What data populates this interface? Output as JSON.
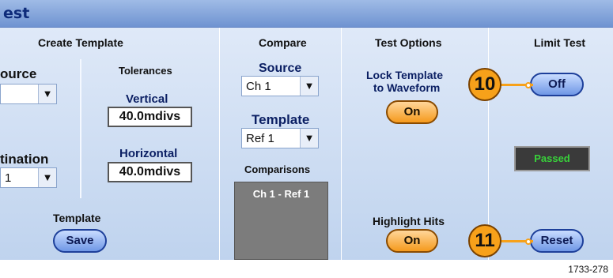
{
  "window": {
    "title": "est"
  },
  "create_template": {
    "section_title": "Create Template",
    "source_label": "ource",
    "source_value": "",
    "tolerances_label": "Tolerances",
    "vertical_label": "Vertical",
    "vertical_value": "40.0mdivs",
    "horizontal_label": "Horizontal",
    "horizontal_value": "40.0mdivs",
    "destination_label": "tination",
    "destination_value": "1",
    "template_label": "Template",
    "save_label": "Save"
  },
  "compare": {
    "section_title": "Compare",
    "source_label": "Source",
    "source_value": "Ch 1",
    "template_label": "Template",
    "template_value": "Ref 1",
    "comparisons_label": "Comparisons",
    "comparisons": [
      "Ch 1 - Ref 1"
    ]
  },
  "test_options": {
    "section_title": "Test Options",
    "lock_label_line1": "Lock Template",
    "lock_label_line2": "to Waveform",
    "lock_value": "On",
    "highlight_label": "Highlight Hits",
    "highlight_value": "On"
  },
  "limit_test": {
    "section_title": "Limit Test",
    "state_value": "Off",
    "status_text": "Passed",
    "reset_label": "Reset"
  },
  "callouts": {
    "c10": "10",
    "c11": "11"
  },
  "figure_id": "1733-278",
  "dropdown_arrow_icon": "triangle-down-icon",
  "colors": {
    "title_bar": "#6f93d1",
    "panel": "#c8daf2",
    "orange_button": "#f59a1d",
    "blue_button": "#6f97e6",
    "callout": "#f7a11a",
    "status_text": "#38d23a"
  }
}
